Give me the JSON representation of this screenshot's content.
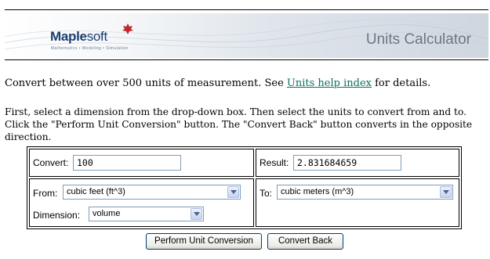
{
  "header": {
    "logo_main": "Maple",
    "logo_soft": "soft",
    "tagline": "Mathematics • Modeling • Simulation",
    "title": "Units Calculator"
  },
  "intro": {
    "text_before": "Convert between over 500 units of measurement. See ",
    "link": "Units help index",
    "text_after": " for details."
  },
  "instructions": "First, select a dimension from the drop-down box. Then select the units to convert from and to. Click the \"Perform Unit Conversion\" button. The \"Convert Back\" button converts in the opposite direction.",
  "form": {
    "convert_label": "Convert:",
    "convert_value": "100",
    "result_label": "Result:",
    "result_value": "2.831684659",
    "from_label": "From:",
    "from_selected": "cubic feet (ft^3)",
    "to_label": "To:",
    "to_selected": "cubic meters (m^3)",
    "dimension_label": "Dimension:",
    "dimension_selected": "volume"
  },
  "buttons": {
    "perform": "Perform Unit Conversion",
    "convert_back": "Convert Back"
  },
  "colors": {
    "link": "#0b6f5f",
    "logo": "#1c3f73",
    "field_border": "#7f9db9"
  }
}
